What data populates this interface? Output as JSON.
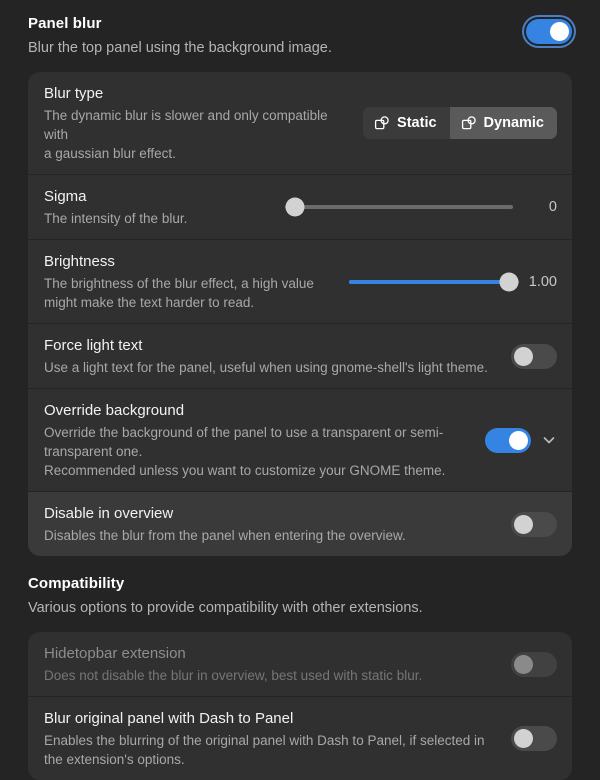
{
  "panel_blur": {
    "title": "Panel blur",
    "subtitle": "Blur the top panel using the background image.",
    "master_toggle": {
      "state": "on",
      "icon": "toggle-switch"
    },
    "rows": [
      {
        "title": "Blur type",
        "subtitle": "The dynamic blur is slower and only compatible with\na gaussian blur effect.",
        "control": "segmented",
        "options": [
          "Static",
          "Dynamic"
        ],
        "selected": "Dynamic",
        "option_icon": "blur-type-icon"
      },
      {
        "title": "Sigma",
        "subtitle": "The intensity of the blur.",
        "control": "slider",
        "value": "0",
        "fill_percent": 0
      },
      {
        "title": "Brightness",
        "subtitle": "The brightness of the blur effect, a high value\nmight make the text harder to read.",
        "control": "slider",
        "value": "1.00",
        "fill_percent": 100
      },
      {
        "title": "Force light text",
        "subtitle": "Use a light text for the panel, useful when using gnome-shell's light theme.",
        "control": "switch",
        "state": "off"
      },
      {
        "title": "Override background",
        "subtitle": "Override the background of the panel to use a transparent or semi-transparent one.\nRecommended unless you want to customize your GNOME theme.",
        "control": "switch-expander",
        "state": "on",
        "expander_icon": "chevron-down-icon"
      },
      {
        "title": "Disable in overview",
        "subtitle": "Disables the blur from the panel when entering the overview.",
        "control": "switch",
        "state": "off",
        "hover": true
      }
    ]
  },
  "compatibility": {
    "title": "Compatibility",
    "subtitle": "Various options to provide compatibility with other extensions.",
    "rows": [
      {
        "title": "Hidetopbar extension",
        "subtitle": "Does not disable the blur in overview, best used with static blur.",
        "control": "switch",
        "state": "off",
        "disabled": true
      },
      {
        "title": "Blur original panel with Dash to Panel",
        "subtitle": "Enables the blurring of the original panel with Dash to Panel, if selected in\nthe extension's options.",
        "control": "switch",
        "state": "off"
      }
    ]
  },
  "colors": {
    "accent": "#3584e4",
    "page_bg": "#242424",
    "card_bg": "#303030",
    "row_hover_bg": "#3a3a3a",
    "title_text": "#f2f2f2",
    "subtitle_text": "#a8a8a8"
  }
}
